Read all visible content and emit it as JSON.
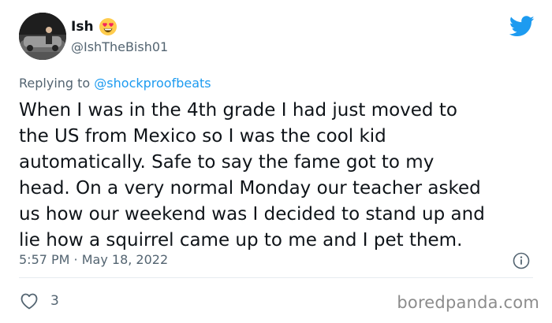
{
  "author": {
    "name": "Ish",
    "handle": "@IshTheBish01"
  },
  "icons": {
    "avatar": "profile-photo",
    "emoji": "heart-eyes-emoji",
    "brand": "twitter-bird-icon",
    "info": "info-icon",
    "like": "heart-icon"
  },
  "reply": {
    "prefix": "Replying to",
    "mention": "@shockproofbeats"
  },
  "tweet": {
    "lines": [
      "When I was in the 4th grade I had just moved to",
      "the US from Mexico so I was the cool kid",
      "automatically. Safe to say the fame got to my",
      "head. On a very normal Monday our teacher asked",
      "us how our weekend was I decided to stand up and",
      "lie how a squirrel came up to me and I pet them."
    ],
    "timestamp": "5:57 PM · May 18, 2022"
  },
  "stats": {
    "likes": "3"
  },
  "watermark": "boredpanda.com",
  "colors": {
    "text": "#0f1419",
    "muted": "#536471",
    "twitter_blue": "#1d9bf0",
    "emoji_yellow": "#ffcc4d",
    "emoji_heart": "#f4245e"
  }
}
